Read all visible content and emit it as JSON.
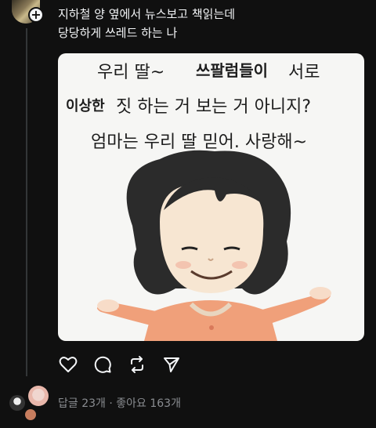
{
  "post": {
    "line1": "지하철 양 옆에서 뉴스보고 책읽는데",
    "line2": "당당하게 쓰레드 하는 나"
  },
  "meme": {
    "row1_a": "우리 딸~",
    "row1_b": "쓰팔럼들이",
    "row1_c": "서로",
    "row2_a": "이상한",
    "row2_b": "짓 하는 거 보는 거 아니지?",
    "row3": "엄마는 우리 딸 믿어.  사랑해~"
  },
  "actions": {
    "like_icon": "heart-icon",
    "comment_icon": "comment-icon",
    "repost_icon": "repost-icon",
    "share_icon": "send-icon"
  },
  "stats": {
    "text": "답글 23개 · 좋아요 163개"
  },
  "colors": {
    "background": "#101010",
    "text": "#f3f5f7",
    "muted": "#8a8d91",
    "image_bg": "#f6f6f4",
    "shirt": "#f0a07a"
  }
}
